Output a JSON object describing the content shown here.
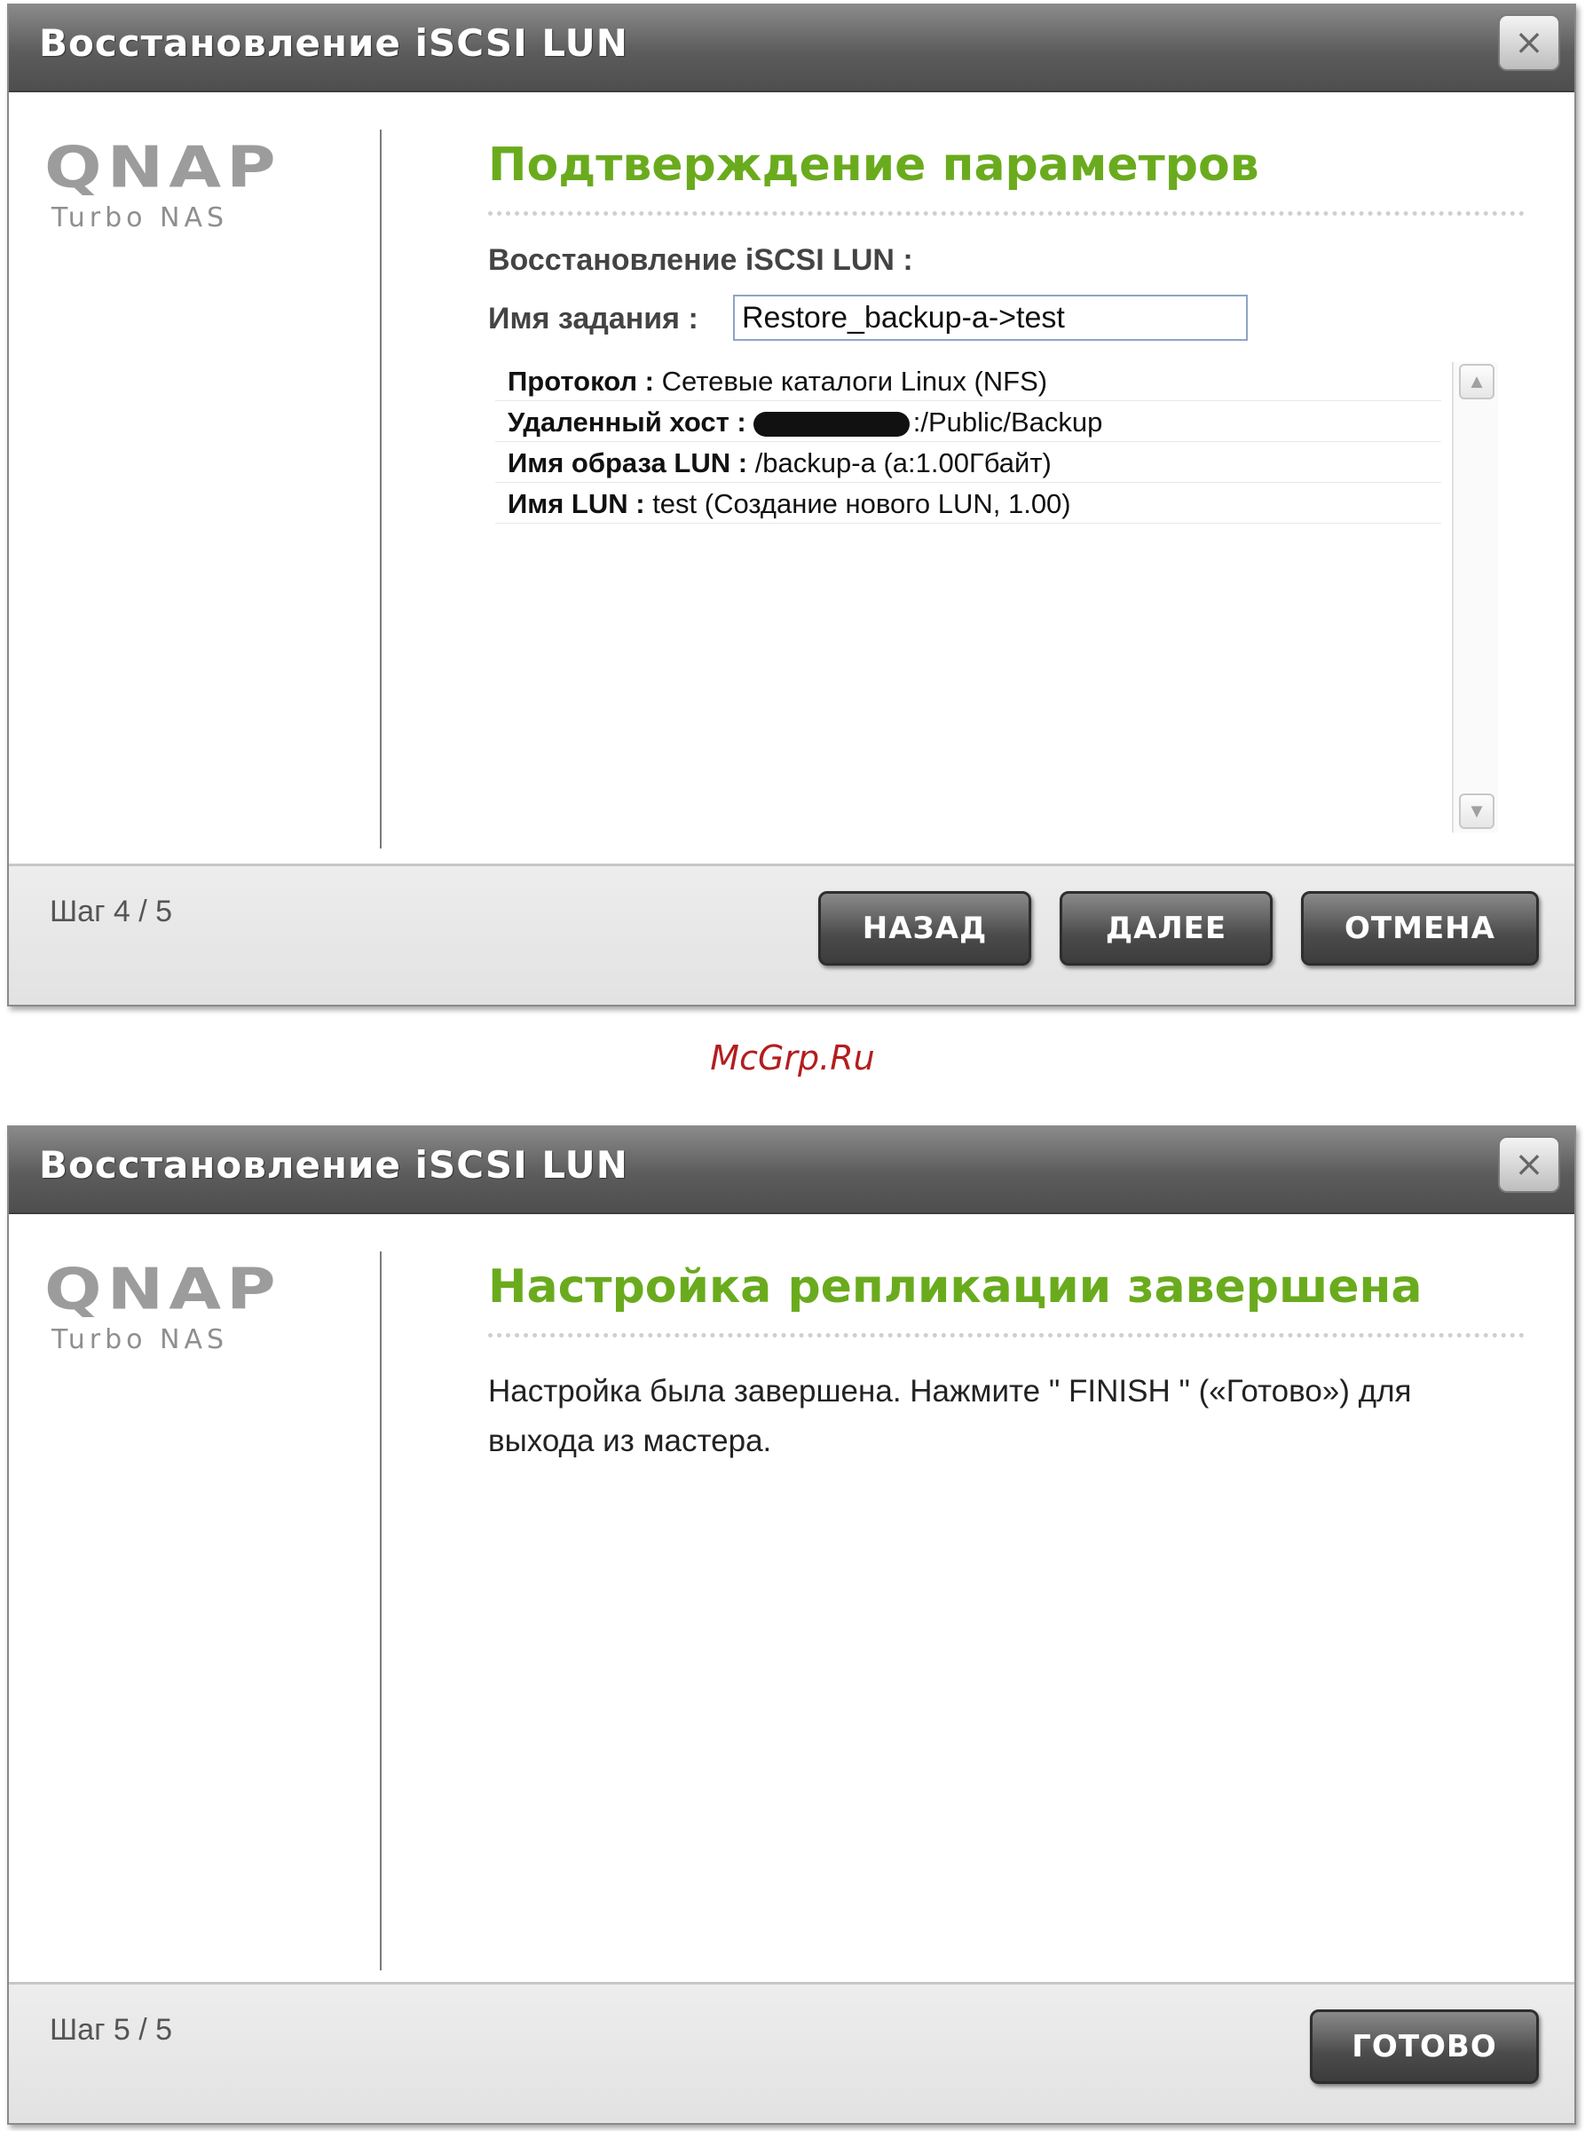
{
  "watermark": "McGrp.Ru",
  "dialog1": {
    "title": "Восстановление iSCSI LUN",
    "close_label": "×",
    "logo": {
      "brand": "QNAP",
      "sub": "Turbo NAS"
    },
    "heading": "Подтверждение параметров",
    "section_label": "Восстановление iSCSI LUN :",
    "job_name_label": "Имя задания :",
    "job_name_value": "Restore_backup-a->test",
    "summary": [
      {
        "key": "Протокол :",
        "value": "Сетевые каталоги Linux (NFS)"
      },
      {
        "key": "Удаленный хост :",
        "value": ":/Public/Backup",
        "redacted": true
      },
      {
        "key": "Имя образа LUN :",
        "value": "/backup-a (a:1.00Гбайт)"
      },
      {
        "key": "Имя LUN :",
        "value": "test (Создание нового LUN, 1.00)"
      }
    ],
    "step": "Шаг 4 / 5",
    "buttons": {
      "back": "НАЗАД",
      "next": "ДАЛЕЕ",
      "cancel": "ОТМЕНА"
    }
  },
  "dialog2": {
    "title": "Восстановление iSCSI LUN",
    "close_label": "×",
    "logo": {
      "brand": "QNAP",
      "sub": "Turbo NAS"
    },
    "heading": "Настройка репликации завершена",
    "message": "Настройка была завершена. Нажмите \" FINISH \" («Готово») для выхода из мастера.",
    "step": "Шаг 5 / 5",
    "buttons": {
      "finish": "ГОТОВО"
    }
  },
  "colors": {
    "accent_green": "#6aab1e",
    "titlebar": "#5c5c5c"
  },
  "icons": {
    "close": "close-icon",
    "scroll_up": "chevron-up-icon",
    "scroll_down": "chevron-down-icon"
  }
}
